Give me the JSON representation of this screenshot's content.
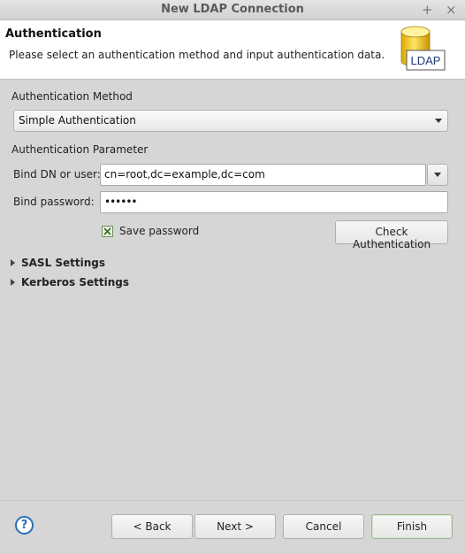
{
  "window": {
    "title": "New LDAP Connection",
    "controls": {
      "add": "+",
      "close": "×"
    }
  },
  "header": {
    "title": "Authentication",
    "description": "Please select an authentication method and input authentication data.",
    "logo_text": "LDAP"
  },
  "auth_method": {
    "label": "Authentication Method",
    "selected": "Simple Authentication"
  },
  "auth_params": {
    "label": "Authentication Parameter",
    "bind_dn_label": "Bind DN or user:",
    "bind_dn_value": "cn=root,dc=example,dc=com",
    "password_label": "Bind password:",
    "password_value": "••••••",
    "save_password_label": "Save password",
    "save_password_checked": true,
    "check_button": "Check Authentication"
  },
  "sections": {
    "sasl": "SASL Settings",
    "kerberos": "Kerberos Settings"
  },
  "footer": {
    "help_icon": "?",
    "back": "< Back",
    "next": "Next >",
    "cancel": "Cancel",
    "finish": "Finish"
  }
}
